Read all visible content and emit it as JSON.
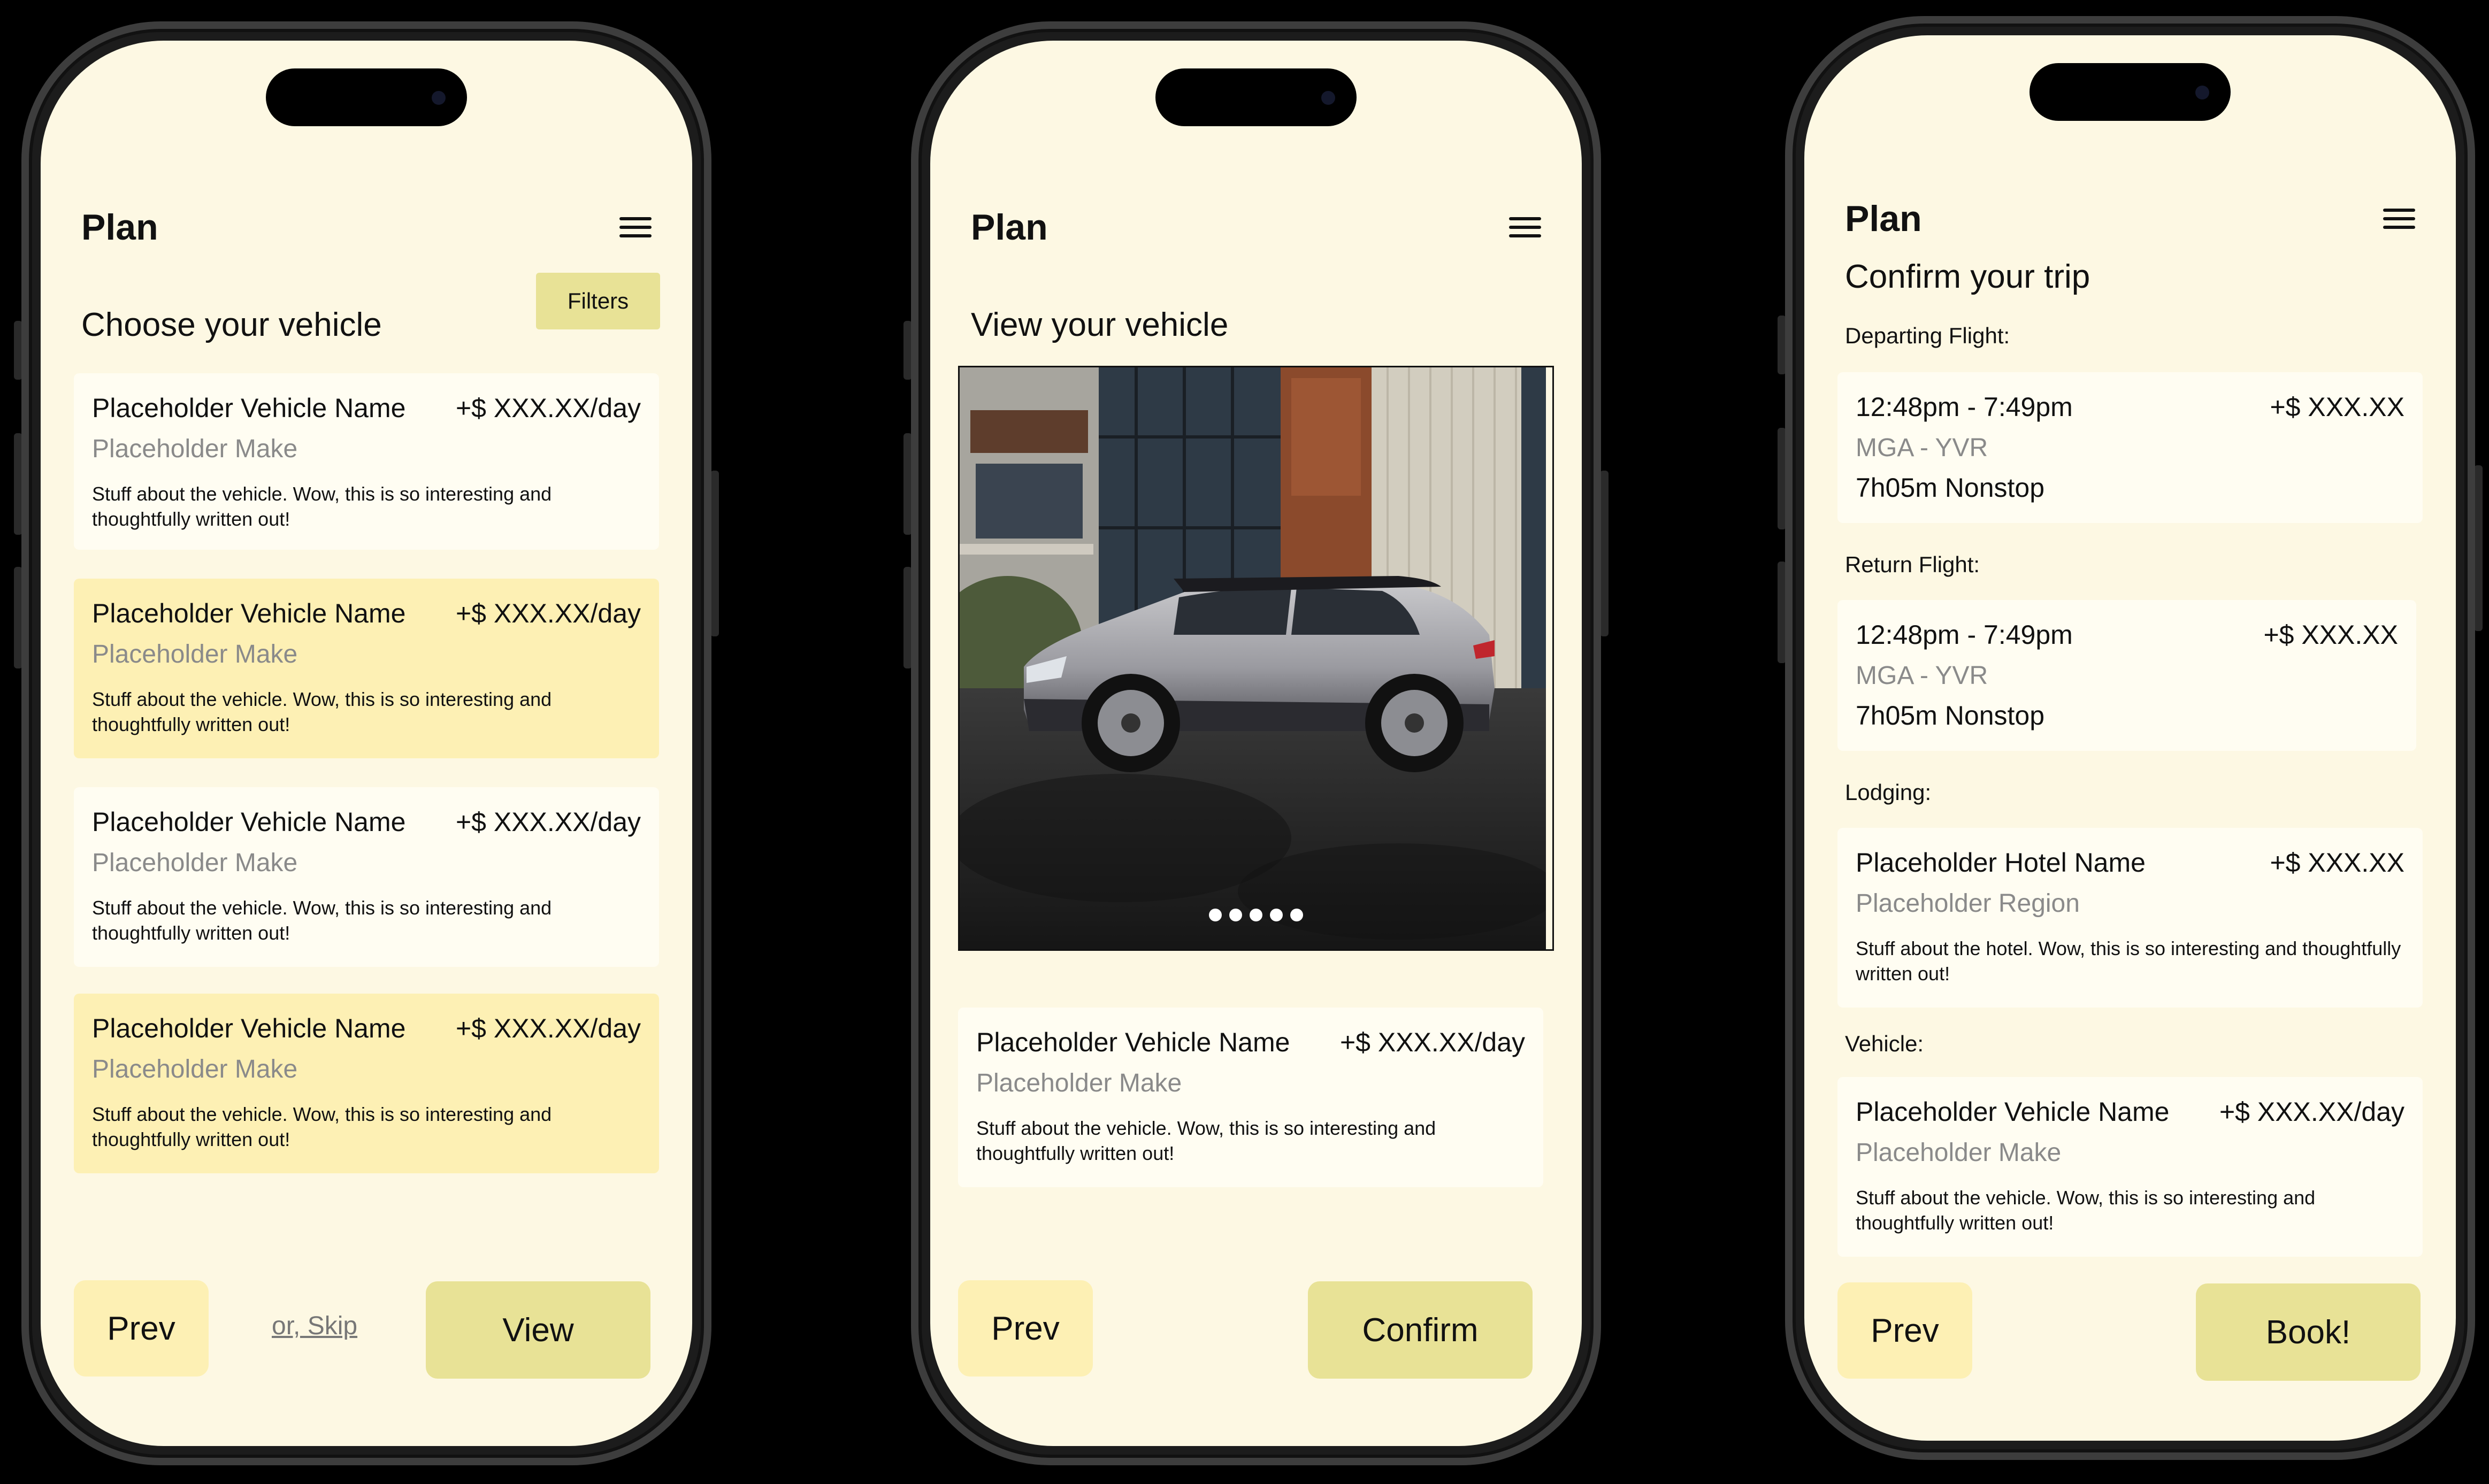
{
  "phone1": {
    "app_title": "Plan",
    "heading": "Choose your vehicle",
    "filters_label": "Filters",
    "vehicles": [
      {
        "name": "Placeholder Vehicle Name",
        "price": "+$ XXX.XX/day",
        "make": "Placeholder Make",
        "desc": "Stuff about the vehicle. Wow, this is so interesting and thoughtfully written out!"
      },
      {
        "name": "Placeholder Vehicle Name",
        "price": "+$ XXX.XX/day",
        "make": "Placeholder Make",
        "desc": "Stuff about the vehicle. Wow, this is so interesting and thoughtfully written out!"
      },
      {
        "name": "Placeholder Vehicle Name",
        "price": "+$ XXX.XX/day",
        "make": "Placeholder Make",
        "desc": "Stuff about the vehicle. Wow, this is so interesting and thoughtfully written out!"
      },
      {
        "name": "Placeholder Vehicle Name",
        "price": "+$ XXX.XX/day",
        "make": "Placeholder Make",
        "desc": "Stuff about the vehicle. Wow, this is so interesting and thoughtfully written out!"
      }
    ],
    "prev_label": "Prev",
    "skip_label": "or, Skip",
    "view_label": "View"
  },
  "phone2": {
    "app_title": "Plan",
    "heading": "View your vehicle",
    "vehicle": {
      "name": "Placeholder Vehicle Name",
      "price": "+$ XXX.XX/day",
      "make": "Placeholder Make",
      "desc": "Stuff about the vehicle. Wow, this is so interesting and thoughtfully written out!"
    },
    "prev_label": "Prev",
    "confirm_label": "Confirm"
  },
  "phone3": {
    "app_title": "Plan",
    "heading": "Confirm your trip",
    "departing_label": "Departing Flight:",
    "departing": {
      "time": "12:48pm - 7:49pm",
      "price": "+$ XXX.XX",
      "route": "MGA - YVR",
      "duration": "7h05m Nonstop"
    },
    "return_label": "Return Flight:",
    "return": {
      "time": "12:48pm - 7:49pm",
      "price": "+$ XXX.XX",
      "route": "MGA - YVR",
      "duration": "7h05m Nonstop"
    },
    "lodging_label": "Lodging:",
    "lodging": {
      "name": "Placeholder Hotel Name",
      "price": "+$ XXX.XX",
      "region": "Placeholder Region",
      "desc": "Stuff about the hotel. Wow, this is so interesting and thoughtfully written out!"
    },
    "vehicle_label": "Vehicle:",
    "vehicle": {
      "name": "Placeholder Vehicle Name",
      "price": "+$ XXX.XX/day",
      "make": "Placeholder Make",
      "desc": "Stuff about the vehicle. Wow, this is so interesting and thoughtfully written out!"
    },
    "prev_label": "Prev",
    "book_label": "Book!"
  },
  "icons": {
    "menu": "hamburger-menu-icon"
  },
  "colors": {
    "screen_bg": "#fdf8e3",
    "card": "#fffdf2",
    "highlight": "#fdf0b4",
    "accent": "#e8e296"
  }
}
